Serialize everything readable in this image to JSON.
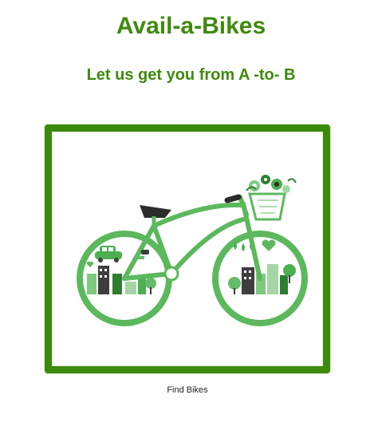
{
  "header": {
    "title": "Avail-a-Bikes",
    "tagline": "Let us get you from A -to- B"
  },
  "hero": {
    "image_alt": "Illustration of a green bicycle with cities, trees and a flower basket",
    "image_icon": "bicycle-illustration",
    "caption": "Find Bikes"
  },
  "colors": {
    "brand_green": "#3f8a0e",
    "frame_green": "#3c8a0b",
    "bike_green": "#5cb85c"
  }
}
